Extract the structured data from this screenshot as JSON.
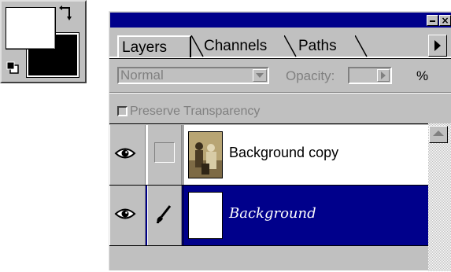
{
  "tools": {
    "foreground_color": "#ffffff",
    "background_color": "#000000"
  },
  "palette": {
    "titlebar_color": "#00008b",
    "tabs": [
      {
        "label": "Layers",
        "active": true
      },
      {
        "label": "Channels",
        "active": false
      },
      {
        "label": "Paths",
        "active": false
      }
    ],
    "blend_mode": "Normal",
    "opacity_label": "Opacity:",
    "opacity_value": "",
    "percent_sign": "%",
    "preserve_transparency_label": "Preserve Transparency",
    "preserve_transparency_checked": false,
    "layers": [
      {
        "name": "Background copy",
        "visible": true,
        "selected": false
      },
      {
        "name": "Background",
        "visible": true,
        "selected": true
      }
    ],
    "selection_color": "#00008b"
  }
}
